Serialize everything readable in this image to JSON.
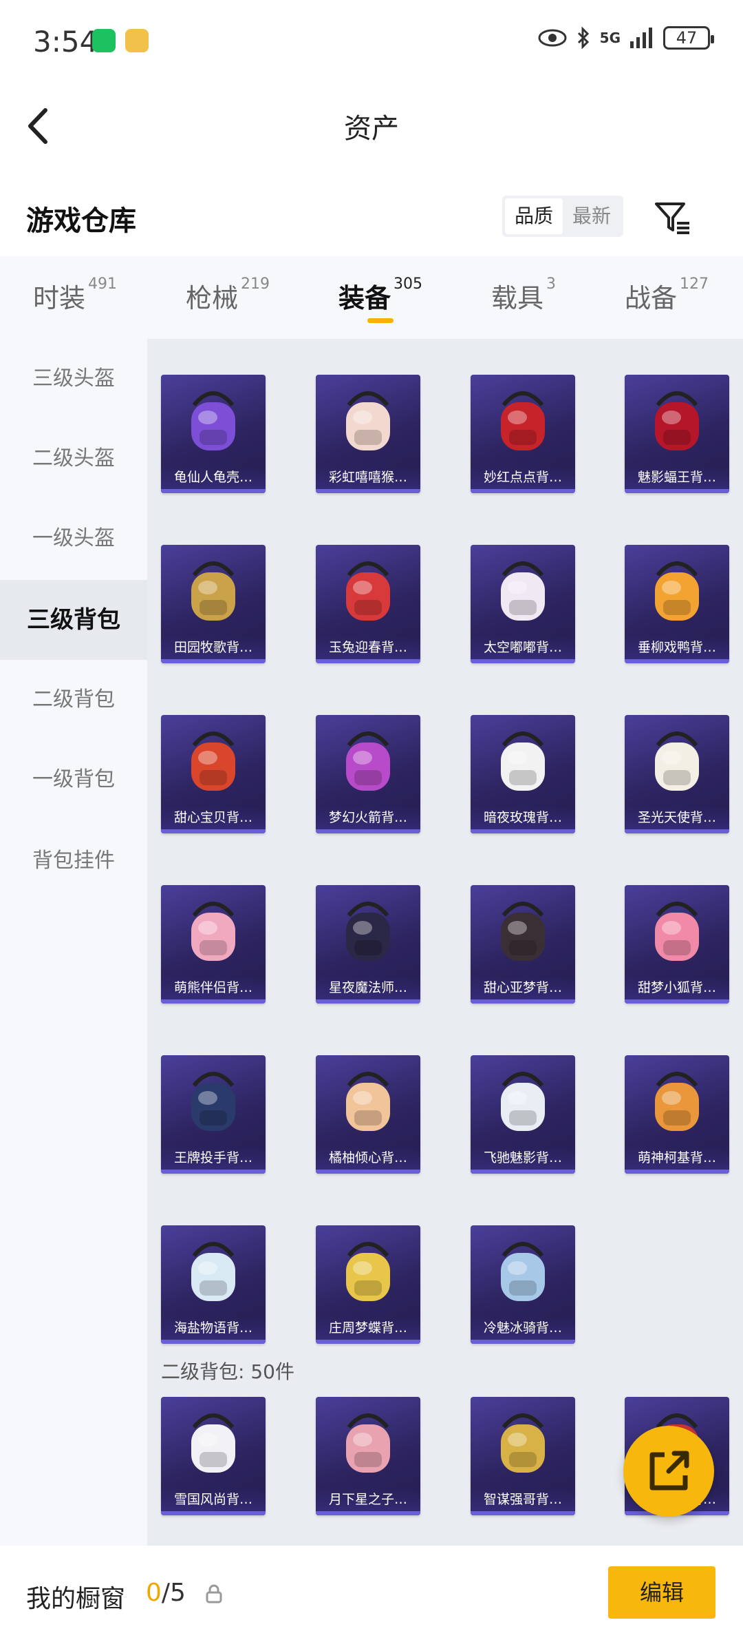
{
  "status": {
    "time": "3:54",
    "signal": "5G",
    "battery": "47"
  },
  "nav": {
    "title": "资产"
  },
  "warehouse": {
    "title": "游戏仓库",
    "sort_options": [
      "品质",
      "最新"
    ]
  },
  "tabs": [
    {
      "label": "时装",
      "count": "491"
    },
    {
      "label": "枪械",
      "count": "219"
    },
    {
      "label": "装备",
      "count": "305"
    },
    {
      "label": "载具",
      "count": "3"
    },
    {
      "label": "战备",
      "count": "127"
    }
  ],
  "sidebar": [
    "三级头盔",
    "二级头盔",
    "一级头盔",
    "三级背包",
    "二级背包",
    "一级背包",
    "背包挂件"
  ],
  "items": [
    {
      "name": "龟仙人龟壳…",
      "color": "#7c4fd6"
    },
    {
      "name": "彩虹嘻嘻猴…",
      "color": "#f3d8cf"
    },
    {
      "name": "妙红点点背…",
      "color": "#c7232a"
    },
    {
      "name": "魅影蝠王背…",
      "color": "#b5162a"
    },
    {
      "name": "田园牧歌背…",
      "color": "#c9a24a"
    },
    {
      "name": "玉兔迎春背…",
      "color": "#d8393a"
    },
    {
      "name": "太空嘟嘟背…",
      "color": "#f0e8f3"
    },
    {
      "name": "垂柳戏鸭背…",
      "color": "#f2a332"
    },
    {
      "name": "甜心宝贝背…",
      "color": "#d9462b"
    },
    {
      "name": "梦幻火箭背…",
      "color": "#b84bc9"
    },
    {
      "name": "暗夜玫瑰背…",
      "color": "#f2f2f2"
    },
    {
      "name": "圣光天使背…",
      "color": "#f3efe4"
    },
    {
      "name": "萌熊伴侣背…",
      "color": "#f1a9c0"
    },
    {
      "name": "星夜魔法师…",
      "color": "#2b2746"
    },
    {
      "name": "甜心亚梦背…",
      "color": "#3b2f36"
    },
    {
      "name": "甜梦小狐背…",
      "color": "#f08aa6"
    },
    {
      "name": "王牌投手背…",
      "color": "#2a3a6a"
    },
    {
      "name": "橘柚倾心背…",
      "color": "#f2c49a"
    },
    {
      "name": "飞驰魅影背…",
      "color": "#e9eef5"
    },
    {
      "name": "萌神柯基背…",
      "color": "#e9973a"
    },
    {
      "name": "海盐物语背…",
      "color": "#d9eaf5"
    },
    {
      "name": "庄周梦蝶背…",
      "color": "#e8c64a"
    },
    {
      "name": "冷魅冰骑背…",
      "color": "#a8c8e8"
    }
  ],
  "section2": {
    "label": "二级背包: 50件"
  },
  "items2": [
    {
      "name": "雪国风尚背…",
      "color": "#f1f1f6"
    },
    {
      "name": "月下星之子…",
      "color": "#e8a2b0"
    },
    {
      "name": "智谋强哥背…",
      "color": "#d8b246"
    },
    {
      "name": "玉兔迎春背…",
      "color": "#c33"
    }
  ],
  "bottom": {
    "title": "我的橱窗",
    "count_now": "0",
    "count_sep": "/5",
    "edit": "编辑"
  }
}
